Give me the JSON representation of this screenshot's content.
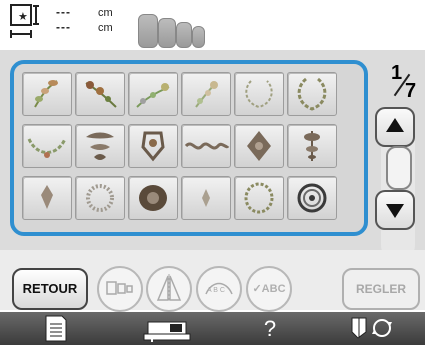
{
  "header": {
    "width_dashes": "---",
    "height_dashes": "---",
    "unit": "cm"
  },
  "pager": {
    "current": "1",
    "total": "7"
  },
  "buttons": {
    "retour": "RETOUR",
    "regler": "REGLER",
    "abc_check": "✓ABC",
    "abc_arc": "A B C"
  },
  "bottom_bar": {
    "help": "?"
  },
  "colors": {
    "accent_border": "#2f8fd0",
    "panel": "#dcdcdc",
    "bottom_bar": "#3e3e3e"
  },
  "patterns": [
    {
      "name": "floral-spray-1"
    },
    {
      "name": "floral-spray-2"
    },
    {
      "name": "floral-spray-3"
    },
    {
      "name": "floral-spray-4"
    },
    {
      "name": "wreath-open"
    },
    {
      "name": "laurel-wreath"
    },
    {
      "name": "garland-arc"
    },
    {
      "name": "ornament-baroque"
    },
    {
      "name": "ornament-crest"
    },
    {
      "name": "border-scroll"
    },
    {
      "name": "ornament-diamond"
    },
    {
      "name": "ornament-floral-vertical"
    },
    {
      "name": "ornament-small"
    },
    {
      "name": "ornament-round"
    },
    {
      "name": "ornament-dense"
    },
    {
      "name": "ornament-tiny"
    },
    {
      "name": "wreath-ring"
    },
    {
      "name": "round-frame"
    }
  ]
}
